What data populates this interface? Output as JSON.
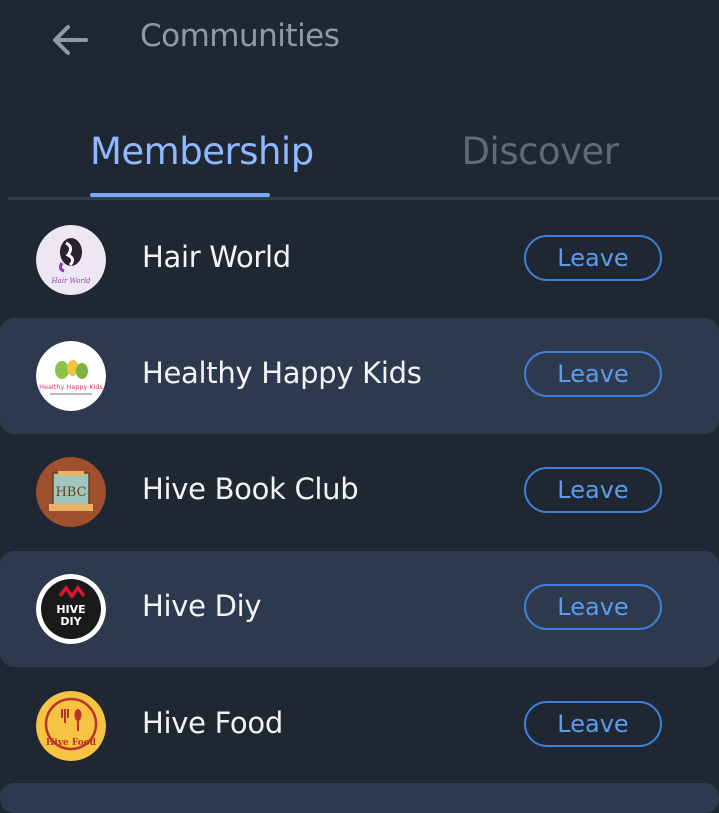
{
  "header": {
    "title": "Communities",
    "back_icon": "arrow-left-icon"
  },
  "tabs": [
    {
      "label": "Membership",
      "active": true
    },
    {
      "label": "Discover",
      "active": false
    }
  ],
  "colors": {
    "background": "#1f2733",
    "row_alt": "#2d3a4e",
    "accent": "#8fb8ff",
    "leave_border": "#3f7fd6"
  },
  "communities": [
    {
      "name": "Hair World",
      "action": "Leave",
      "logo_text": "Hair World"
    },
    {
      "name": "Healthy Happy Kids",
      "action": "Leave",
      "logo_text": "Healthy Happy Kids"
    },
    {
      "name": "Hive Book Club",
      "action": "Leave",
      "logo_text": "HBC"
    },
    {
      "name": "Hive Diy",
      "action": "Leave",
      "logo_text": "HIVE DIY"
    },
    {
      "name": "Hive Food",
      "action": "Leave",
      "logo_text": "Hive Food"
    }
  ]
}
